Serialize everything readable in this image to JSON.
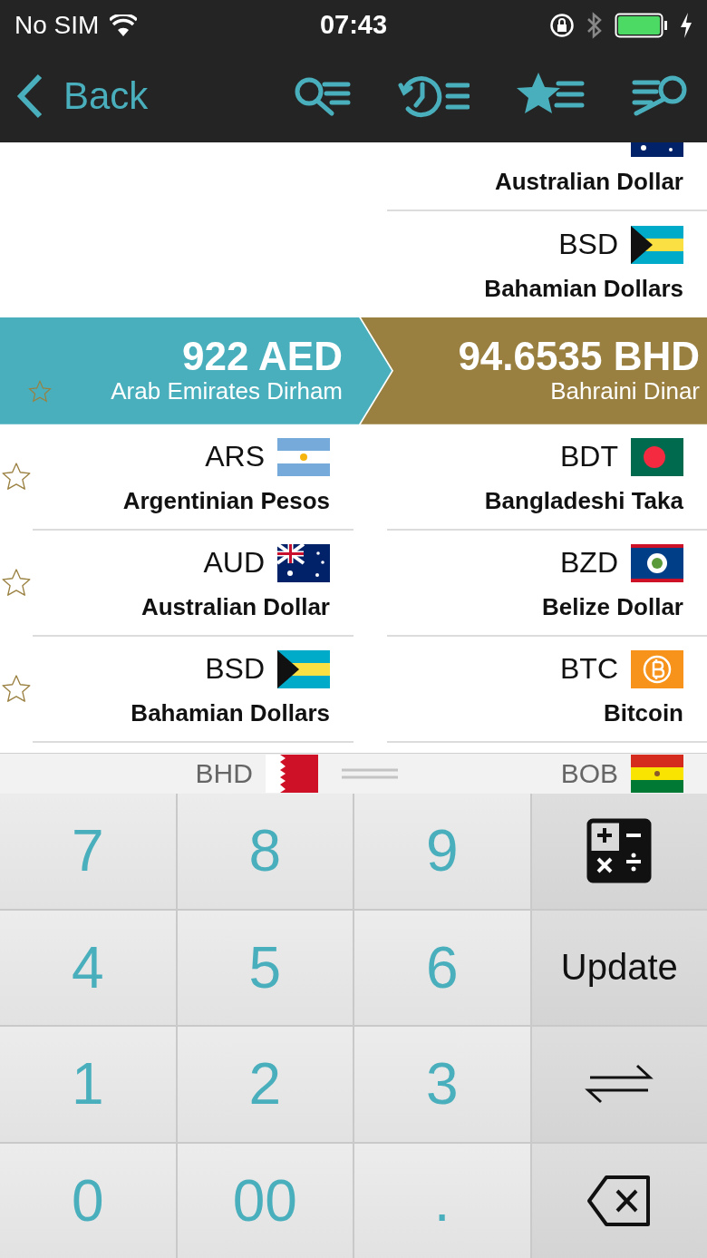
{
  "status_bar": {
    "carrier": "No SIM",
    "time": "07:43"
  },
  "nav": {
    "back": "Back"
  },
  "upper_right_rows": [
    {
      "name": "Australian Dollar",
      "kind": "australia"
    },
    {
      "code": "BSD",
      "name": "Bahamian Dollars",
      "kind": "bahamas"
    }
  ],
  "conversion": {
    "from": {
      "amount": "922 AED",
      "name": "Arab Emirates Dirham",
      "favorite": false
    },
    "to": {
      "amount": "94.6535 BHD",
      "name": "Bahraini Dinar"
    }
  },
  "from_list": [
    {
      "code": "ARS",
      "name": "Argentinian Pesos",
      "kind": "argentina",
      "favorite": false
    },
    {
      "code": "AUD",
      "name": "Australian Dollar",
      "kind": "australia",
      "favorite": false
    },
    {
      "code": "BSD",
      "name": "Bahamian Dollars",
      "kind": "bahamas",
      "favorite": false
    }
  ],
  "to_list": [
    {
      "code": "BDT",
      "name": "Bangladeshi Taka",
      "kind": "bangladesh"
    },
    {
      "code": "BZD",
      "name": "Belize Dollar",
      "kind": "belize"
    },
    {
      "code": "BTC",
      "name": "Bitcoin",
      "kind": "bitcoin"
    }
  ],
  "peek_row": {
    "left": {
      "code": "BHD",
      "kind": "bahrain"
    },
    "right": {
      "code": "BOB",
      "kind": "bolivia"
    }
  },
  "keypad": [
    {
      "kind": "digit",
      "label": "7"
    },
    {
      "kind": "digit",
      "label": "8"
    },
    {
      "kind": "digit",
      "label": "9"
    },
    {
      "kind": "calculator"
    },
    {
      "kind": "digit",
      "label": "4"
    },
    {
      "kind": "digit",
      "label": "5"
    },
    {
      "kind": "digit",
      "label": "6"
    },
    {
      "kind": "text",
      "label": "Update"
    },
    {
      "kind": "digit",
      "label": "1"
    },
    {
      "kind": "digit",
      "label": "2"
    },
    {
      "kind": "digit",
      "label": "3"
    },
    {
      "kind": "swap"
    },
    {
      "kind": "digit",
      "label": "0"
    },
    {
      "kind": "digit",
      "label": "00"
    },
    {
      "kind": "digit",
      "label": "."
    },
    {
      "kind": "backspace"
    }
  ]
}
